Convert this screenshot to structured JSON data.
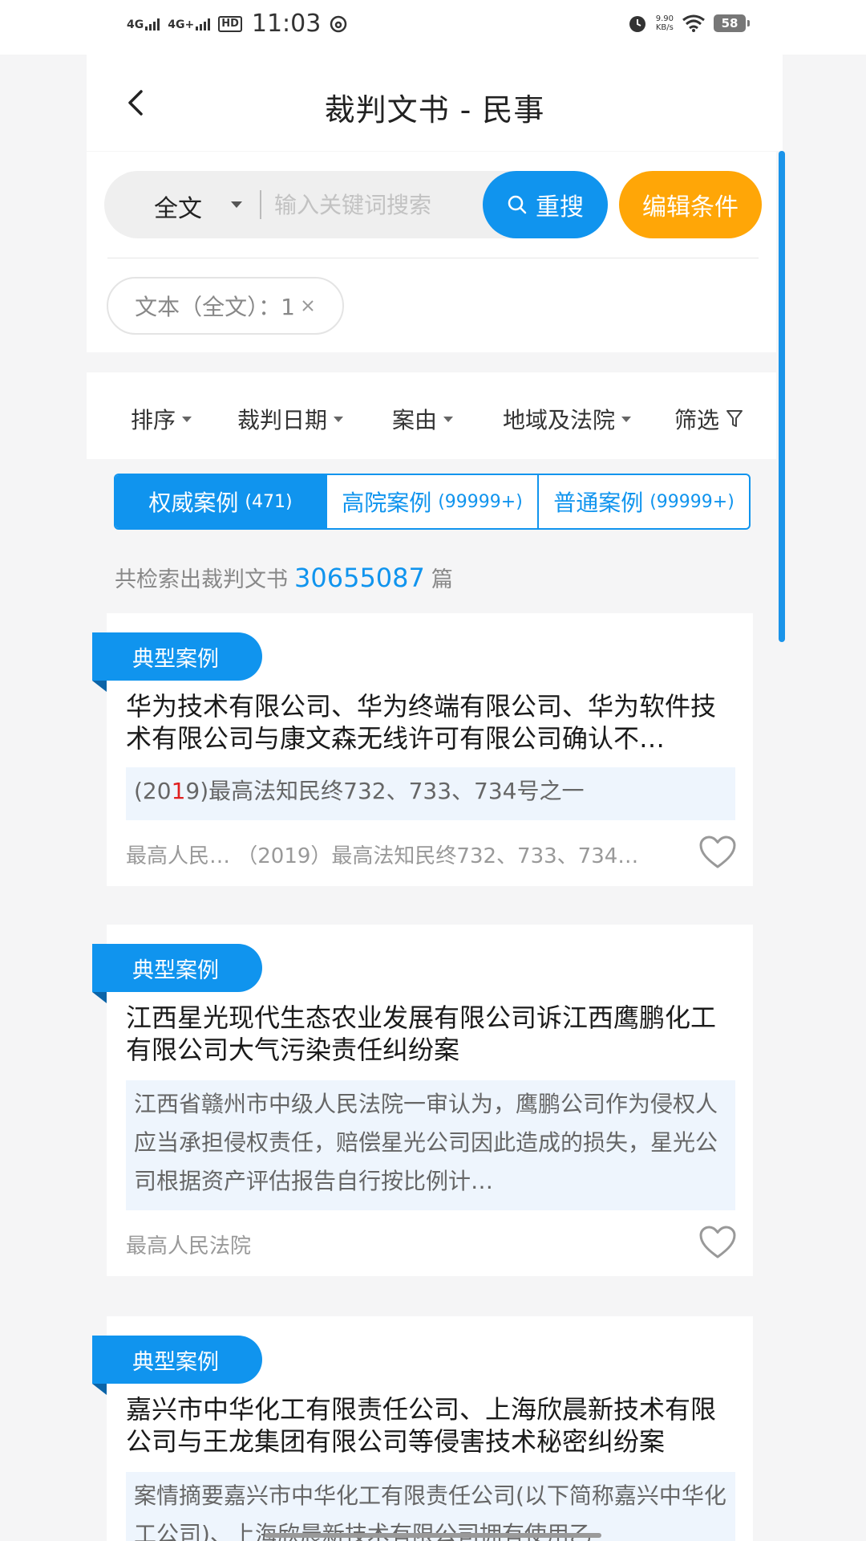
{
  "status_bar": {
    "net1": "4G",
    "net2": "4G+",
    "hd": "HD",
    "time": "11:03",
    "speed_value": "9.90",
    "speed_unit": "KB/s",
    "battery": "58"
  },
  "header": {
    "title": "裁判文书 - 民事"
  },
  "search": {
    "scope": "全文",
    "placeholder": "输入关键词搜索",
    "research_label": "重搜",
    "edit_label": "编辑条件",
    "chip_label": "文本（全文）：1"
  },
  "filters": [
    {
      "label": "排序"
    },
    {
      "label": "裁判日期"
    },
    {
      "label": "案由"
    },
    {
      "label": "地域及法院"
    },
    {
      "label": "筛选"
    }
  ],
  "tabs": [
    {
      "label": "权威案例",
      "count": "(471)"
    },
    {
      "label": "高院案例",
      "count": "(99999+)"
    },
    {
      "label": "普通案例",
      "count": "(99999+)"
    }
  ],
  "results": {
    "prefix": "共检索出裁判文书",
    "count": "30655087",
    "suffix": "篇"
  },
  "cards": [
    {
      "badge": "典型案例",
      "title": "华为技术有限公司、华为终端有限公司、华为软件技术有限公司与康文森无线许可有限公司确认不…",
      "summary_a": "(20",
      "summary_hl": "1",
      "summary_b": "9)最高法知民终732、733、734号之一",
      "meta": "最高人民…  （2019）最高法知民终732、733、734…"
    },
    {
      "badge": "典型案例",
      "title": "江西星光现代生态农业发展有限公司诉江西鹰鹏化工有限公司大气污染责任纠纷案",
      "summary": "江西省赣州市中级人民法院一审认为，鹰鹏公司作为侵权人应当承担侵权责任，赔偿星光公司因此造成的损失，星光公司根据资产评估报告自行按比例计…",
      "meta": "最高人民法院"
    },
    {
      "badge": "典型案例",
      "title": "嘉兴市中华化工有限责任公司、上海欣晨新技术有限公司与王龙集团有限公司等侵害技术秘密纠纷案",
      "summary": "案情摘要嘉兴市中华化工有限责任公司(以下简称嘉兴中华化工公司)、上海欣晨新技术有限公司拥有使用乙"
    }
  ]
}
